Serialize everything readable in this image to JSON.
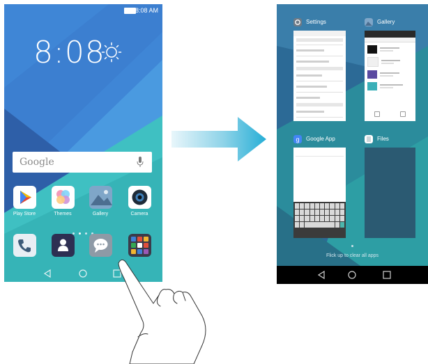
{
  "left_phone": {
    "status_time": "8:08 AM",
    "clock": "8:08",
    "search_label": "Google",
    "apps_row1": [
      {
        "label": "Play Store",
        "icon": "play-store-icon"
      },
      {
        "label": "Themes",
        "icon": "themes-icon"
      },
      {
        "label": "Gallery",
        "icon": "gallery-icon"
      },
      {
        "label": "Camera",
        "icon": "camera-icon"
      }
    ],
    "apps_row2": [
      {
        "icon": "phone-icon"
      },
      {
        "icon": "contacts-icon"
      },
      {
        "icon": "messages-icon"
      },
      {
        "icon": "app-folder-icon"
      }
    ]
  },
  "right_phone": {
    "cards": [
      {
        "title": "Settings",
        "icon": "settings-icon"
      },
      {
        "title": "Gallery",
        "icon": "gallery-icon"
      },
      {
        "title": "Google App",
        "icon": "google-icon"
      },
      {
        "title": "Files",
        "icon": "files-icon"
      }
    ],
    "clear_hint": "Flick up to clear all apps"
  },
  "colors": {
    "wallpaper_blue": "#3f86d6",
    "wallpaper_dark": "#2e5fa8",
    "wallpaper_teal": "#3fc0c2",
    "arrow_cyan": "#33b4d6"
  }
}
